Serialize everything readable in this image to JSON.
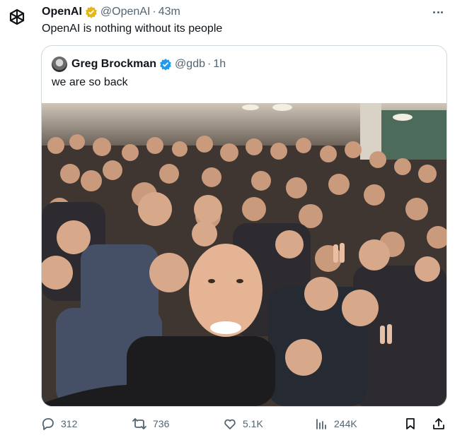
{
  "tweet": {
    "author_name": "OpenAI",
    "author_handle": "@OpenAI",
    "time": "43m",
    "text": "OpenAI is nothing without its people"
  },
  "quote": {
    "author_name": "Greg Brockman",
    "author_handle": "@gdb",
    "time": "1h",
    "text": "we are so back",
    "image_alt": "Group selfie of OpenAI staff in an office"
  },
  "actions": {
    "replies": "312",
    "reposts": "736",
    "likes": "5.1K",
    "views": "244K"
  },
  "colors": {
    "verified_gold": "#e2b719",
    "verified_blue": "#1d9bf0",
    "secondary_text": "#536471",
    "border": "#cfd9de"
  },
  "icons": [
    "openai-logo-icon",
    "verified-gold-icon",
    "verified-blue-icon",
    "more-icon",
    "reply-icon",
    "repost-icon",
    "like-icon",
    "views-icon",
    "bookmark-icon",
    "share-icon"
  ]
}
